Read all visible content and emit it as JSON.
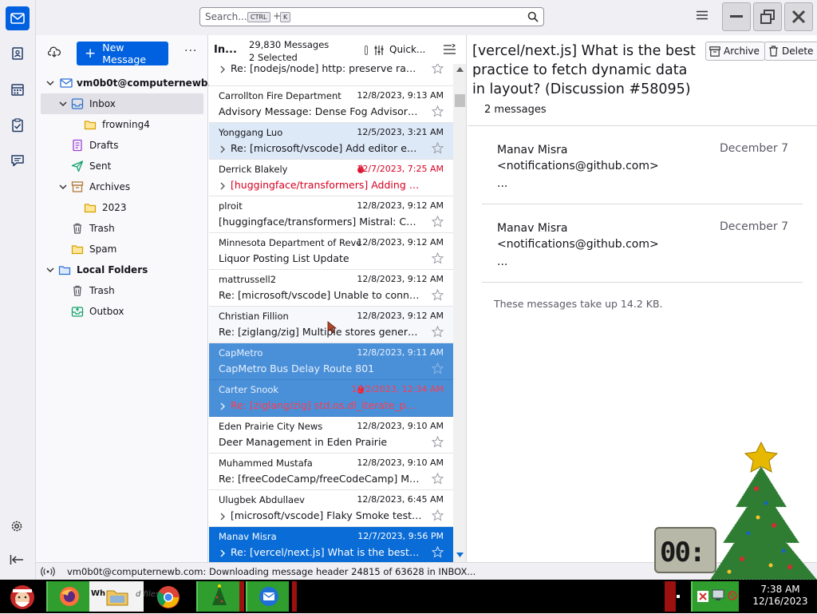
{
  "search": {
    "placeholder": "Search...",
    "kbd1": "CTRL",
    "plus": "+",
    "kbd2": "K"
  },
  "account": {
    "name": "vm0b0t@computernewb...."
  },
  "new_message_label": "New Message",
  "folders": [
    {
      "label": "Inbox"
    },
    {
      "label": "frowning4"
    },
    {
      "label": "Drafts"
    },
    {
      "label": "Sent"
    },
    {
      "label": "Archives"
    },
    {
      "label": "2023"
    },
    {
      "label": "Trash"
    },
    {
      "label": "Spam"
    }
  ],
  "local_folders": {
    "label": "Local Folders",
    "items": [
      {
        "label": "Trash"
      },
      {
        "label": "Outbox"
      }
    ]
  },
  "list_header": {
    "folder": "In...",
    "count": "29,830 Messages",
    "selected": "2 Selected",
    "quick_filter": "Quick..."
  },
  "messages": [
    {
      "subject": "Re: [nodejs/node] http: preserve raw he..."
    },
    {
      "sender": "Carrollton Fire Department",
      "date": "12/8/2023, 9:13 AM",
      "subject": "Advisory Message: Dense Fog Advisory un..."
    },
    {
      "sender": "Yonggang Luo",
      "date": "12/5/2023, 3:21 AM",
      "subject": "Re: [microsoft/vscode] Add editor enco..."
    },
    {
      "sender": "Derrick Blakely",
      "date": "12/7/2023, 7:25 AM",
      "subject": "[huggingface/transformers] Adding the sa..."
    },
    {
      "sender": "plroit",
      "date": "12/8/2023, 9:12 AM",
      "subject": "[huggingface/transformers] Mistral: CUDA ..."
    },
    {
      "sender": "Minnesota Department of Reve...",
      "date": "12/8/2023, 9:12 AM",
      "subject": "Liquor Posting List Update"
    },
    {
      "sender": "mattrussell2",
      "date": "12/8/2023, 9:12 AM",
      "subject": "Re: [microsoft/vscode] Unable to connect t..."
    },
    {
      "sender": "Christian Fillion",
      "date": "12/8/2023, 9:12 AM",
      "subject": "Re: [ziglang/zig] Multiple stores generated..."
    },
    {
      "sender": "CapMetro",
      "date": "12/8/2023, 9:11 AM",
      "subject": "CapMetro Bus Delay Route 801"
    },
    {
      "sender": "Carter Snook",
      "date": "12/2/2023, 12:34 AM",
      "subject": "Re: [ziglang/zig] std.os.dl_iterate_phdr: re..."
    },
    {
      "sender": "Eden Prairie City News",
      "date": "12/8/2023, 9:10 AM",
      "subject": "Deer Management in Eden Prairie"
    },
    {
      "sender": "Muhammed Mustafa",
      "date": "12/8/2023, 9:10 AM",
      "subject": "Re: [freeCodeCamp/freeCodeCamp] Migra..."
    },
    {
      "sender": "Ulugbek Abdullaev",
      "date": "12/8/2023, 6:45 AM",
      "subject": "[microsoft/vscode] Flaky Smoke test fail..."
    },
    {
      "sender": "Manav Misra",
      "date": "12/7/2023, 9:56 PM",
      "subject": "Re: [vercel/next.js] What is the best prac..."
    }
  ],
  "reader": {
    "title": "[vercel/next.js] What is the best practice to fetch dynamic data in layout? (Discussion #58095)",
    "count": "2 messages",
    "archive_label": "Archive",
    "delete_label": "Delete",
    "cards": [
      {
        "from": "Manav Misra <notifications@github.com>",
        "date": "December 7",
        "body": "..."
      },
      {
        "from": "Manav Misra <notifications@github.com>",
        "date": "December 7",
        "body": "..."
      }
    ],
    "size_note": "These messages take up 14.2 KB."
  },
  "status": {
    "text": "vm0b0t@computernewb.com: Downloading message header 24815 of 63628 in INBOX..."
  },
  "taskbar": {
    "file_hint": "d files",
    "time": "7:38 AM",
    "date": "12/16/2023"
  },
  "gadget": {
    "digits": "00:"
  },
  "colors": {
    "accent": "#0061e0",
    "selection": "#4a90d9",
    "current": "#0a6cd6",
    "unread_red": "#d70022"
  }
}
